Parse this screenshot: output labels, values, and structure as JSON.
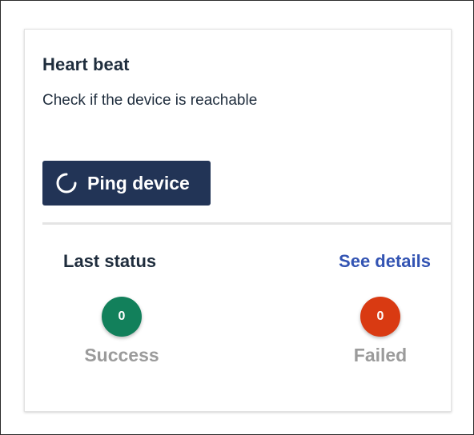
{
  "card": {
    "title": "Heart beat",
    "description": "Check if the device is reachable",
    "ping_button_label": "Ping device",
    "ping_button_icon": "spinner-icon"
  },
  "status": {
    "heading": "Last status",
    "details_link": "See details",
    "success": {
      "count": "0",
      "label": "Success",
      "color": "#12805b"
    },
    "failed": {
      "count": "0",
      "label": "Failed",
      "color": "#d93a12"
    }
  },
  "colors": {
    "button_bg": "#223456",
    "link": "#3354b3",
    "text": "#1f2d3d",
    "muted": "#9b9b9b"
  }
}
